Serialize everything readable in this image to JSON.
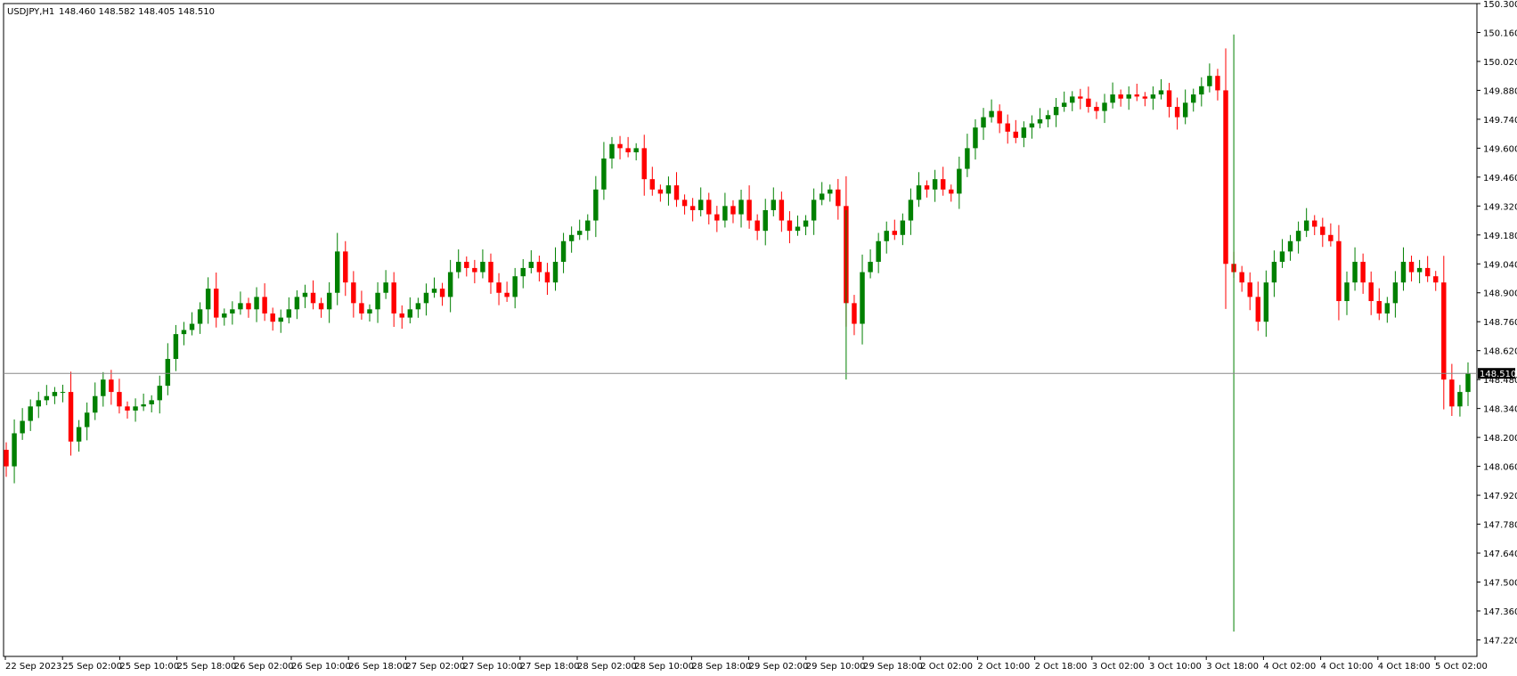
{
  "header": {
    "symbol": "USDJPY,H1",
    "ohlc": "148.460 148.582 148.405 148.510"
  },
  "colors": {
    "bull": "#008000",
    "bear": "#ff0000",
    "price_tag_bg": "#000000",
    "grid": "#000000"
  },
  "chart_data": {
    "type": "candlestick",
    "symbol": "USDJPY",
    "timeframe": "H1",
    "current_price": "148.510",
    "ylim": [
      147.14,
      150.3
    ],
    "y_ticks": [
      "150.300",
      "150.160",
      "150.020",
      "149.880",
      "149.740",
      "149.600",
      "149.460",
      "149.320",
      "149.180",
      "149.040",
      "148.900",
      "148.760",
      "148.620",
      "148.480",
      "148.340",
      "148.200",
      "148.060",
      "147.920",
      "147.780",
      "147.640",
      "147.500",
      "147.360",
      "147.220"
    ],
    "x_ticks": [
      "22 Sep 2023",
      "25 Sep 02:00",
      "25 Sep 10:00",
      "25 Sep 18:00",
      "26 Sep 02:00",
      "26 Sep 10:00",
      "26 Sep 18:00",
      "27 Sep 02:00",
      "27 Sep 10:00",
      "27 Sep 18:00",
      "28 Sep 02:00",
      "28 Sep 10:00",
      "28 Sep 18:00",
      "29 Sep 02:00",
      "29 Sep 10:00",
      "29 Sep 18:00",
      "2 Oct 02:00",
      "2 Oct 10:00",
      "2 Oct 18:00",
      "3 Oct 02:00",
      "3 Oct 10:00",
      "3 Oct 18:00",
      "4 Oct 02:00",
      "4 Oct 10:00",
      "4 Oct 18:00",
      "5 Oct 02:00"
    ],
    "close_path": [
      148.06,
      148.22,
      148.28,
      148.35,
      148.38,
      148.4,
      148.42,
      148.42,
      148.18,
      148.25,
      148.32,
      148.4,
      148.48,
      148.42,
      148.35,
      148.33,
      148.35,
      148.36,
      148.38,
      148.45,
      148.58,
      148.7,
      148.72,
      148.75,
      148.82,
      148.92,
      148.78,
      148.8,
      148.82,
      148.85,
      148.82,
      148.88,
      148.8,
      148.76,
      148.78,
      148.82,
      148.88,
      148.9,
      148.85,
      148.82,
      148.9,
      149.1,
      148.95,
      148.85,
      148.8,
      148.82,
      148.9,
      148.95,
      148.8,
      148.78,
      148.82,
      148.85,
      148.9,
      148.92,
      148.88,
      149.0,
      149.05,
      149.02,
      149.0,
      149.05,
      148.95,
      148.9,
      148.88,
      148.98,
      149.02,
      149.05,
      149.0,
      148.95,
      149.05,
      149.15,
      149.18,
      149.2,
      149.25,
      149.4,
      149.55,
      149.62,
      149.6,
      149.58,
      149.6,
      149.45,
      149.4,
      149.38,
      149.42,
      149.35,
      149.32,
      149.3,
      149.35,
      149.28,
      149.25,
      149.32,
      149.28,
      149.35,
      149.25,
      149.2,
      149.3,
      149.35,
      149.25,
      149.2,
      149.22,
      149.25,
      149.35,
      149.38,
      149.4,
      149.32,
      148.85,
      148.75,
      149.0,
      149.05,
      149.15,
      149.2,
      149.18,
      149.25,
      149.35,
      149.42,
      149.4,
      149.45,
      149.4,
      149.38,
      149.5,
      149.6,
      149.7,
      149.75,
      149.78,
      149.72,
      149.68,
      149.65,
      149.7,
      149.72,
      149.74,
      149.76,
      149.8,
      149.82,
      149.85,
      149.84,
      149.8,
      149.78,
      149.82,
      149.86,
      149.84,
      149.86,
      149.85,
      149.84,
      149.86,
      149.88,
      149.8,
      149.75,
      149.82,
      149.86,
      149.9,
      149.95,
      149.88,
      149.04,
      149.0,
      148.95,
      148.88,
      148.76,
      148.95,
      149.05,
      149.1,
      149.15,
      149.2,
      149.25,
      149.22,
      149.18,
      149.15,
      148.86,
      148.95,
      149.05,
      148.95,
      148.86,
      148.8,
      148.85,
      148.95,
      149.05,
      149.0,
      149.02,
      148.98,
      148.95,
      148.48,
      148.35,
      148.42,
      148.51
    ]
  }
}
